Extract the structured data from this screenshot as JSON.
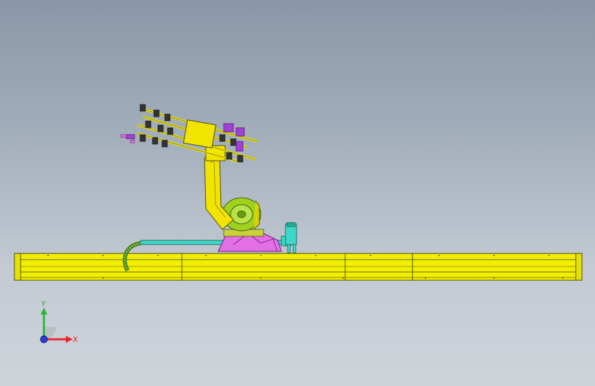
{
  "scene": {
    "background_top": "#8a97a8",
    "background_bottom": "#cfd4da",
    "rail_color": "#f2ee00",
    "arm_color": "#f0e400",
    "base_color": "#e36fe6",
    "cable_color": "#3fd8c8",
    "joint_color": "#9fd21e"
  },
  "triad": {
    "x_label": "X",
    "y_label": "Y",
    "x_color": "#e8262b",
    "y_color": "#27b53a",
    "z_color": "#2a3fd8"
  }
}
